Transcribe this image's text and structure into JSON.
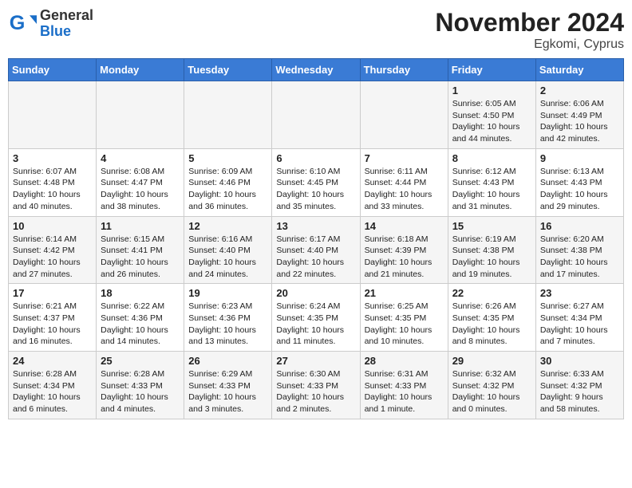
{
  "header": {
    "logo_general": "General",
    "logo_blue": "Blue",
    "title": "November 2024",
    "subtitle": "Egkomi, Cyprus"
  },
  "weekdays": [
    "Sunday",
    "Monday",
    "Tuesday",
    "Wednesday",
    "Thursday",
    "Friday",
    "Saturday"
  ],
  "weeks": [
    [
      {
        "day": "",
        "info": ""
      },
      {
        "day": "",
        "info": ""
      },
      {
        "day": "",
        "info": ""
      },
      {
        "day": "",
        "info": ""
      },
      {
        "day": "",
        "info": ""
      },
      {
        "day": "1",
        "info": "Sunrise: 6:05 AM\nSunset: 4:50 PM\nDaylight: 10 hours\nand 44 minutes."
      },
      {
        "day": "2",
        "info": "Sunrise: 6:06 AM\nSunset: 4:49 PM\nDaylight: 10 hours\nand 42 minutes."
      }
    ],
    [
      {
        "day": "3",
        "info": "Sunrise: 6:07 AM\nSunset: 4:48 PM\nDaylight: 10 hours\nand 40 minutes."
      },
      {
        "day": "4",
        "info": "Sunrise: 6:08 AM\nSunset: 4:47 PM\nDaylight: 10 hours\nand 38 minutes."
      },
      {
        "day": "5",
        "info": "Sunrise: 6:09 AM\nSunset: 4:46 PM\nDaylight: 10 hours\nand 36 minutes."
      },
      {
        "day": "6",
        "info": "Sunrise: 6:10 AM\nSunset: 4:45 PM\nDaylight: 10 hours\nand 35 minutes."
      },
      {
        "day": "7",
        "info": "Sunrise: 6:11 AM\nSunset: 4:44 PM\nDaylight: 10 hours\nand 33 minutes."
      },
      {
        "day": "8",
        "info": "Sunrise: 6:12 AM\nSunset: 4:43 PM\nDaylight: 10 hours\nand 31 minutes."
      },
      {
        "day": "9",
        "info": "Sunrise: 6:13 AM\nSunset: 4:43 PM\nDaylight: 10 hours\nand 29 minutes."
      }
    ],
    [
      {
        "day": "10",
        "info": "Sunrise: 6:14 AM\nSunset: 4:42 PM\nDaylight: 10 hours\nand 27 minutes."
      },
      {
        "day": "11",
        "info": "Sunrise: 6:15 AM\nSunset: 4:41 PM\nDaylight: 10 hours\nand 26 minutes."
      },
      {
        "day": "12",
        "info": "Sunrise: 6:16 AM\nSunset: 4:40 PM\nDaylight: 10 hours\nand 24 minutes."
      },
      {
        "day": "13",
        "info": "Sunrise: 6:17 AM\nSunset: 4:40 PM\nDaylight: 10 hours\nand 22 minutes."
      },
      {
        "day": "14",
        "info": "Sunrise: 6:18 AM\nSunset: 4:39 PM\nDaylight: 10 hours\nand 21 minutes."
      },
      {
        "day": "15",
        "info": "Sunrise: 6:19 AM\nSunset: 4:38 PM\nDaylight: 10 hours\nand 19 minutes."
      },
      {
        "day": "16",
        "info": "Sunrise: 6:20 AM\nSunset: 4:38 PM\nDaylight: 10 hours\nand 17 minutes."
      }
    ],
    [
      {
        "day": "17",
        "info": "Sunrise: 6:21 AM\nSunset: 4:37 PM\nDaylight: 10 hours\nand 16 minutes."
      },
      {
        "day": "18",
        "info": "Sunrise: 6:22 AM\nSunset: 4:36 PM\nDaylight: 10 hours\nand 14 minutes."
      },
      {
        "day": "19",
        "info": "Sunrise: 6:23 AM\nSunset: 4:36 PM\nDaylight: 10 hours\nand 13 minutes."
      },
      {
        "day": "20",
        "info": "Sunrise: 6:24 AM\nSunset: 4:35 PM\nDaylight: 10 hours\nand 11 minutes."
      },
      {
        "day": "21",
        "info": "Sunrise: 6:25 AM\nSunset: 4:35 PM\nDaylight: 10 hours\nand 10 minutes."
      },
      {
        "day": "22",
        "info": "Sunrise: 6:26 AM\nSunset: 4:35 PM\nDaylight: 10 hours\nand 8 minutes."
      },
      {
        "day": "23",
        "info": "Sunrise: 6:27 AM\nSunset: 4:34 PM\nDaylight: 10 hours\nand 7 minutes."
      }
    ],
    [
      {
        "day": "24",
        "info": "Sunrise: 6:28 AM\nSunset: 4:34 PM\nDaylight: 10 hours\nand 6 minutes."
      },
      {
        "day": "25",
        "info": "Sunrise: 6:28 AM\nSunset: 4:33 PM\nDaylight: 10 hours\nand 4 minutes."
      },
      {
        "day": "26",
        "info": "Sunrise: 6:29 AM\nSunset: 4:33 PM\nDaylight: 10 hours\nand 3 minutes."
      },
      {
        "day": "27",
        "info": "Sunrise: 6:30 AM\nSunset: 4:33 PM\nDaylight: 10 hours\nand 2 minutes."
      },
      {
        "day": "28",
        "info": "Sunrise: 6:31 AM\nSunset: 4:33 PM\nDaylight: 10 hours\nand 1 minute."
      },
      {
        "day": "29",
        "info": "Sunrise: 6:32 AM\nSunset: 4:32 PM\nDaylight: 10 hours\nand 0 minutes."
      },
      {
        "day": "30",
        "info": "Sunrise: 6:33 AM\nSunset: 4:32 PM\nDaylight: 9 hours\nand 58 minutes."
      }
    ]
  ]
}
